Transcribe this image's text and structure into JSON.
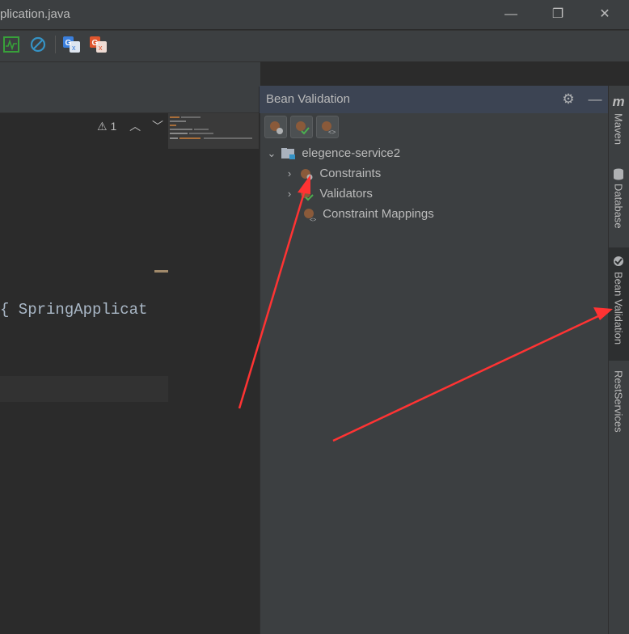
{
  "window": {
    "title": "plication.java",
    "minimize_glyph": "—",
    "restore_glyph": "❐",
    "close_glyph": "✕"
  },
  "toolbar": {
    "icons": [
      "activity-monitor-icon",
      "no-entry-icon",
      "google-translate-icon",
      "google-translate-red-icon"
    ]
  },
  "editor": {
    "inspection_count": "1",
    "code_text": "{ SpringApplicat"
  },
  "tool_window": {
    "title": "Bean Validation",
    "tree": {
      "root": "elegence-service2",
      "children": [
        {
          "label": "Constraints",
          "expandable": true
        },
        {
          "label": "Validators",
          "expandable": true
        },
        {
          "label": "Constraint Mappings",
          "expandable": false
        }
      ]
    }
  },
  "right_stripe": {
    "maven": "Maven",
    "maven_icon": "m",
    "database": "Database",
    "bean_validation": "Bean Validation",
    "rest_services": "RestServices"
  },
  "colors": {
    "accent_red": "#ff3333",
    "bg_dark": "#2b2b2b",
    "panel": "#3c3f41",
    "header_active": "#3c4453"
  }
}
